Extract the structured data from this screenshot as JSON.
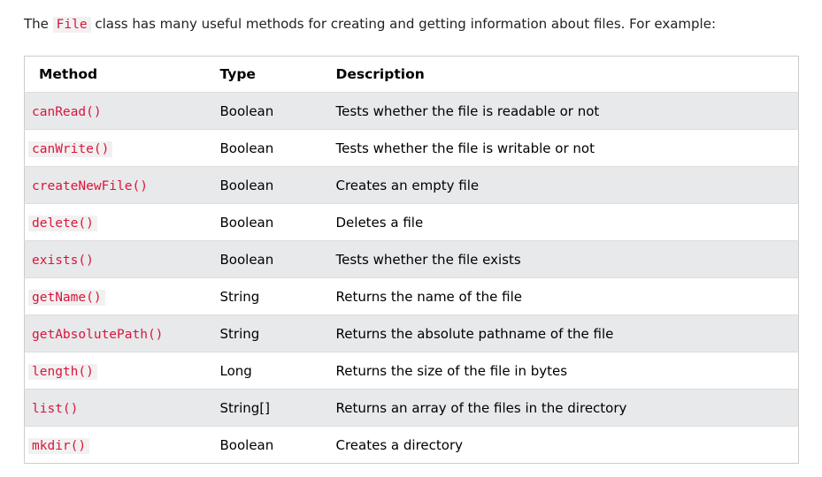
{
  "intro": {
    "before": "The ",
    "class_name": "File",
    "after": " class has many useful methods for creating and getting information about files. For example:"
  },
  "table": {
    "headers": {
      "method": "Method",
      "type": "Type",
      "description": "Description"
    },
    "rows": [
      {
        "method": "canRead()",
        "type": "Boolean",
        "description": "Tests whether the file is readable or not"
      },
      {
        "method": "canWrite()",
        "type": "Boolean",
        "description": "Tests whether the file is writable or not"
      },
      {
        "method": "createNewFile()",
        "type": "Boolean",
        "description": "Creates an empty file"
      },
      {
        "method": "delete()",
        "type": "Boolean",
        "description": "Deletes a file"
      },
      {
        "method": "exists()",
        "type": "Boolean",
        "description": "Tests whether the file exists"
      },
      {
        "method": "getName()",
        "type": "String",
        "description": "Returns the name of the file"
      },
      {
        "method": "getAbsolutePath()",
        "type": "String",
        "description": "Returns the absolute pathname of the file"
      },
      {
        "method": "length()",
        "type": "Long",
        "description": "Returns the size of the file in bytes"
      },
      {
        "method": "list()",
        "type": "String[]",
        "description": "Returns an array of the files in the directory"
      },
      {
        "method": "mkdir()",
        "type": "Boolean",
        "description": "Creates a directory"
      }
    ]
  },
  "colors": {
    "code_text": "#dc143c",
    "code_background": "#f1f1f1",
    "striped_row": "#e7e9eb",
    "table_border": "#cccccc"
  }
}
